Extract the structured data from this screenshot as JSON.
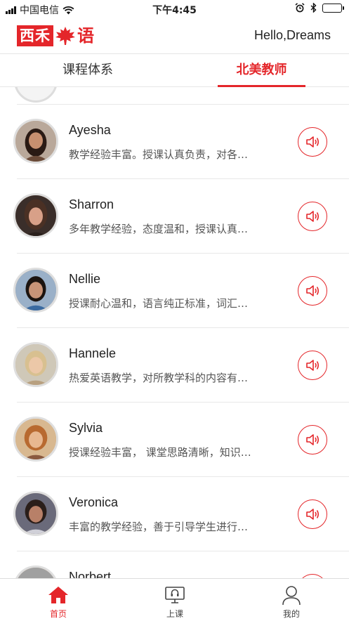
{
  "status_bar": {
    "carrier": "中国电信",
    "time": "下午4:45"
  },
  "header": {
    "logo_text": "西禾",
    "logo_tail": "语",
    "greeting": "Hello,Dreams"
  },
  "tabs": [
    {
      "label": "课程体系",
      "active": false
    },
    {
      "label": "北美教师",
      "active": true
    }
  ],
  "teachers": [
    {
      "name": "Ayesha",
      "description": "教学经验丰富。授课认真负责，对各…"
    },
    {
      "name": "Sharron",
      "description": "多年教学经验，态度温和，授课认真…"
    },
    {
      "name": "Nellie",
      "description": "授课耐心温和，语言纯正标准，词汇…"
    },
    {
      "name": "Hannele",
      "description": "热爱英语教学，对所教学科的内容有…"
    },
    {
      "name": "Sylvia",
      "description": "授课经验丰富， 课堂思路清晰，知识…"
    },
    {
      "name": "Veronica",
      "description": "丰富的教学经验，善于引导学生进行…"
    },
    {
      "name": "Norbert",
      "description": ""
    }
  ],
  "bottom_nav": [
    {
      "label": "首页",
      "icon": "home-icon",
      "active": true
    },
    {
      "label": "上课",
      "icon": "monitor-headset-icon",
      "active": false
    },
    {
      "label": "我的",
      "icon": "user-icon",
      "active": false
    }
  ],
  "colors": {
    "accent": "#e4262a",
    "text": "#222222",
    "muted": "#555555",
    "divider": "#e8e8e8"
  }
}
